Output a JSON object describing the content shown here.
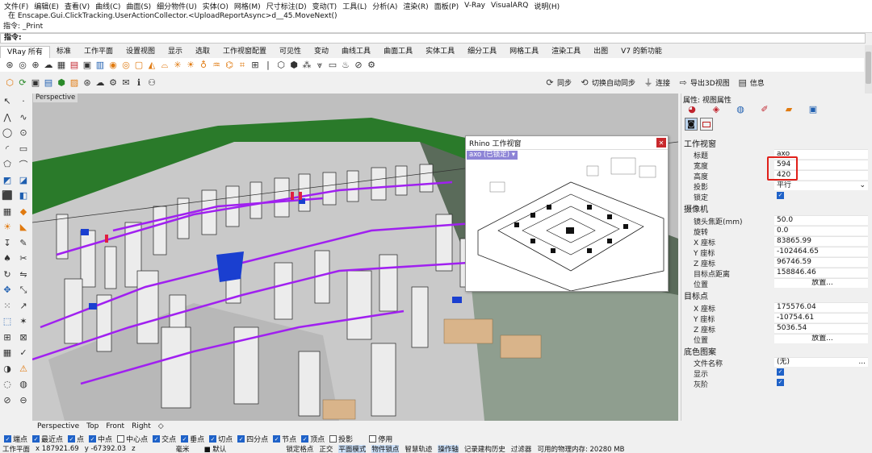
{
  "menu": [
    "文件(F)",
    "编辑(E)",
    "查看(V)",
    "曲线(C)",
    "曲面(S)",
    "细分物件(U)",
    "实体(O)",
    "网格(M)",
    "尺寸标注(D)",
    "变动(T)",
    "工具(L)",
    "分析(A)",
    "渲染(R)",
    "面板(P)",
    "V-Ray",
    "VisualARQ",
    "说明(H)"
  ],
  "command_history": [
    "在 Enscape.Gui.ClickTracking.UserActionCollector.<UploadReportAsync>d__45.MoveNext()",
    "指令: _Print"
  ],
  "command_prompt": "指令:",
  "toolbar_tabs": [
    "VRay 所有",
    "标准",
    "工作平面",
    "设置视图",
    "显示",
    "选取",
    "工作视窗配置",
    "可见性",
    "变动",
    "曲线工具",
    "曲面工具",
    "实体工具",
    "细分工具",
    "网格工具",
    "渲染工具",
    "出图",
    "V7 的新功能"
  ],
  "active_tab": "VRay 所有",
  "rhino_sync": {
    "sync": "同步",
    "auto_sync": "切换自动同步",
    "connect": "连接",
    "export_3d": "导出3D视图",
    "info": "信息"
  },
  "viewport": {
    "title": "Perspective",
    "tabs": [
      "Perspective",
      "Top",
      "Front",
      "Right"
    ]
  },
  "rhino_window": {
    "title": "Rhino 工作视窗",
    "view_label": "axo (已锁定)"
  },
  "osnaps": [
    {
      "label": "端点",
      "checked": true
    },
    {
      "label": "最近点",
      "checked": true
    },
    {
      "label": "点",
      "checked": true
    },
    {
      "label": "中点",
      "checked": true
    },
    {
      "label": "中心点",
      "checked": false
    },
    {
      "label": "交点",
      "checked": true
    },
    {
      "label": "垂点",
      "checked": true
    },
    {
      "label": "切点",
      "checked": true
    },
    {
      "label": "四分点",
      "checked": true
    },
    {
      "label": "节点",
      "checked": true
    },
    {
      "label": "顶点",
      "checked": true
    },
    {
      "label": "投影",
      "checked": false
    },
    {
      "label": "停用",
      "checked": false
    }
  ],
  "statusbar": {
    "plane": "工作平面",
    "x": "x 187921.69",
    "y": "y -67392.03",
    "z": "z",
    "unit": "毫米",
    "layer": "默认",
    "lock_grid": "锁定格点",
    "ortho": "正交",
    "planar": "平面模式",
    "osnap": "物件锁点",
    "smarttrack": "智慧轨迹",
    "gumball": "操作轴",
    "history": "记录建构历史",
    "filter": "过滤器",
    "memory": "可用的物理内存: 20280 MB"
  },
  "panel": {
    "title": "属性: 视图属性",
    "viewport_section": "工作视窗",
    "camera_section": "摄像机",
    "target_section": "目标点",
    "background_section": "底色图案",
    "rows": {
      "title_label": "标题",
      "title_value": "axo",
      "width_label": "宽度",
      "width_value": "594",
      "height_label": "高度",
      "height_value": "420",
      "projection_label": "投影",
      "projection_value": "平行",
      "locked_label": "锁定",
      "lens_label": "镜头焦距(mm)",
      "lens_value": "50.0",
      "rotation_label": "旋转",
      "rotation_value": "0.0",
      "cam_x_label": "X 座标",
      "cam_x_value": "83865.99",
      "cam_y_label": "Y 座标",
      "cam_y_value": "-102464.65",
      "cam_z_label": "Z 座标",
      "cam_z_value": "96746.59",
      "target_dist_label": "目标点距离",
      "target_dist_value": "158846.46",
      "position_label": "位置",
      "position_button": "放置...",
      "tgt_x_label": "X 座标",
      "tgt_x_value": "175576.04",
      "tgt_y_label": "Y 座标",
      "tgt_y_value": "-10754.61",
      "tgt_z_label": "Z 座标",
      "tgt_z_value": "5036.54",
      "tgt_position_label": "位置",
      "tgt_position_button": "放置...",
      "filename_label": "文件名称",
      "filename_value": "(无)",
      "show_label": "显示",
      "gray_label": "灰阶"
    }
  }
}
